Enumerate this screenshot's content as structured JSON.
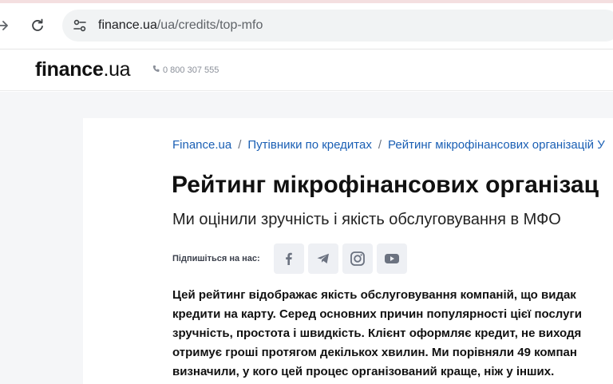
{
  "browser": {
    "url_domain": "finance.ua",
    "url_path": "/ua/credits/top-mfo",
    "forward_icon": "arrow-right-icon",
    "reload_icon": "reload-icon",
    "site_info_icon": "tune-icon"
  },
  "header": {
    "logo_bold": "finance",
    "logo_rest": ".ua",
    "phone": "0 800 307 555"
  },
  "breadcrumb": {
    "items": [
      "Finance.ua",
      "Путівники по кредитах",
      "Рейтинг мікрофінансових організацій У"
    ],
    "separator": "/"
  },
  "article": {
    "title": "Рейтинг мікрофінансових організац",
    "subtitle": "Ми оцінили зручність і якість обслуговування в МФО",
    "follow_label": "Підпишіться на нас:",
    "socials": [
      "facebook-icon",
      "telegram-icon",
      "instagram-icon",
      "youtube-icon"
    ],
    "intro_lines": [
      "Цей рейтинг відображає якість обслуговування компаній, що видак",
      "кредити на карту. Серед основних причин популярності цієї послуги",
      "зручність, простота і швидкість. Клієнт оформляє кредит, не виходя",
      "отримує гроші протягом декількох хвилин. Ми порівняли 49 компан",
      "визначили, у кого цей процес організований краще, ніж у інших."
    ]
  },
  "colors": {
    "link": "#1a5fb4",
    "page_bg": "#f5f6f8",
    "social_bg": "#eef0f4",
    "omnibox_bg": "#f1f3f4"
  }
}
